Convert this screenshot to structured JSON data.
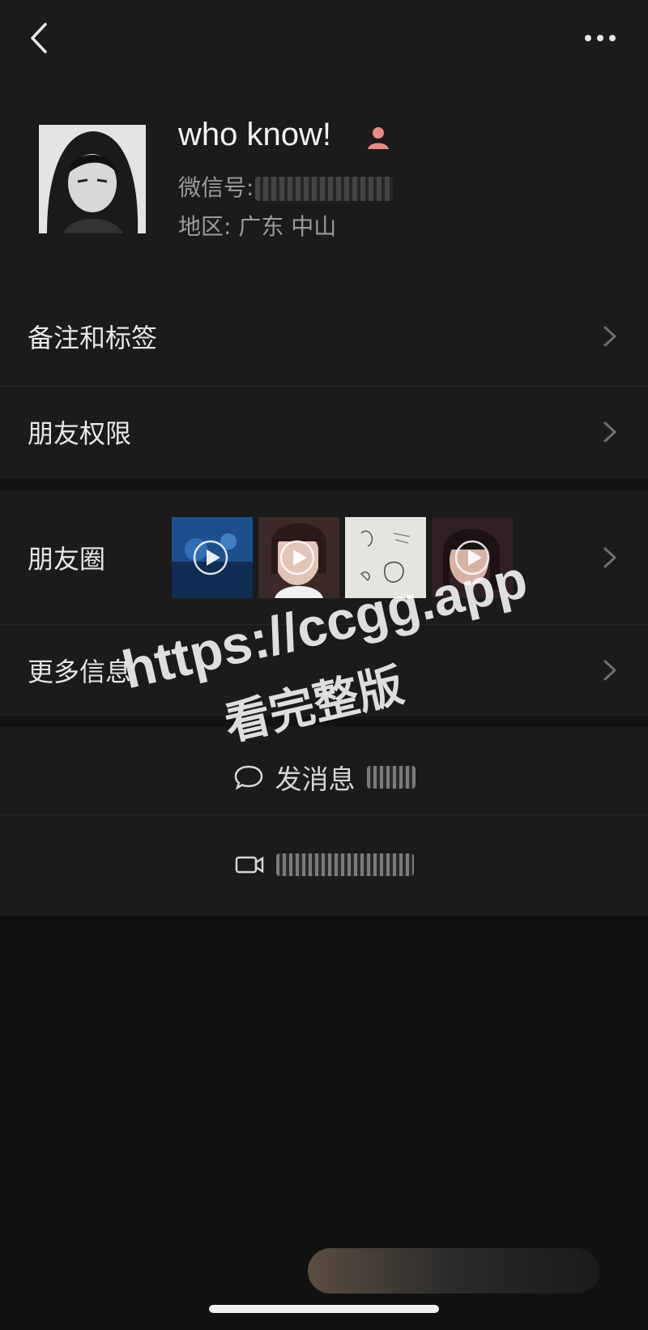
{
  "profile": {
    "nickname": "who know!",
    "wechat_id_label": "微信号:",
    "region_label": "地区:",
    "region_value": "广东 中山",
    "gender_icon": "female-person-icon",
    "gender_color": "#e88a86"
  },
  "nav": {
    "back_icon": "chevron-left-icon",
    "more_icon": "more-dots-icon"
  },
  "cells": {
    "remarks_tags": "备注和标签",
    "friend_permissions": "朋友权限",
    "moments": "朋友圈",
    "more_info": "更多信息"
  },
  "actions": {
    "send_message": "发消息",
    "message_icon": "chat-bubble-icon",
    "video_icon": "video-camera-icon"
  },
  "watermark": {
    "line1": "https://ccgg.app",
    "line2": "看完整版"
  },
  "colors": {
    "background": "#1b1b1b",
    "text": "#e6e6e6",
    "secondary_text": "#9b9b9b",
    "watermark": "#ffffff"
  }
}
